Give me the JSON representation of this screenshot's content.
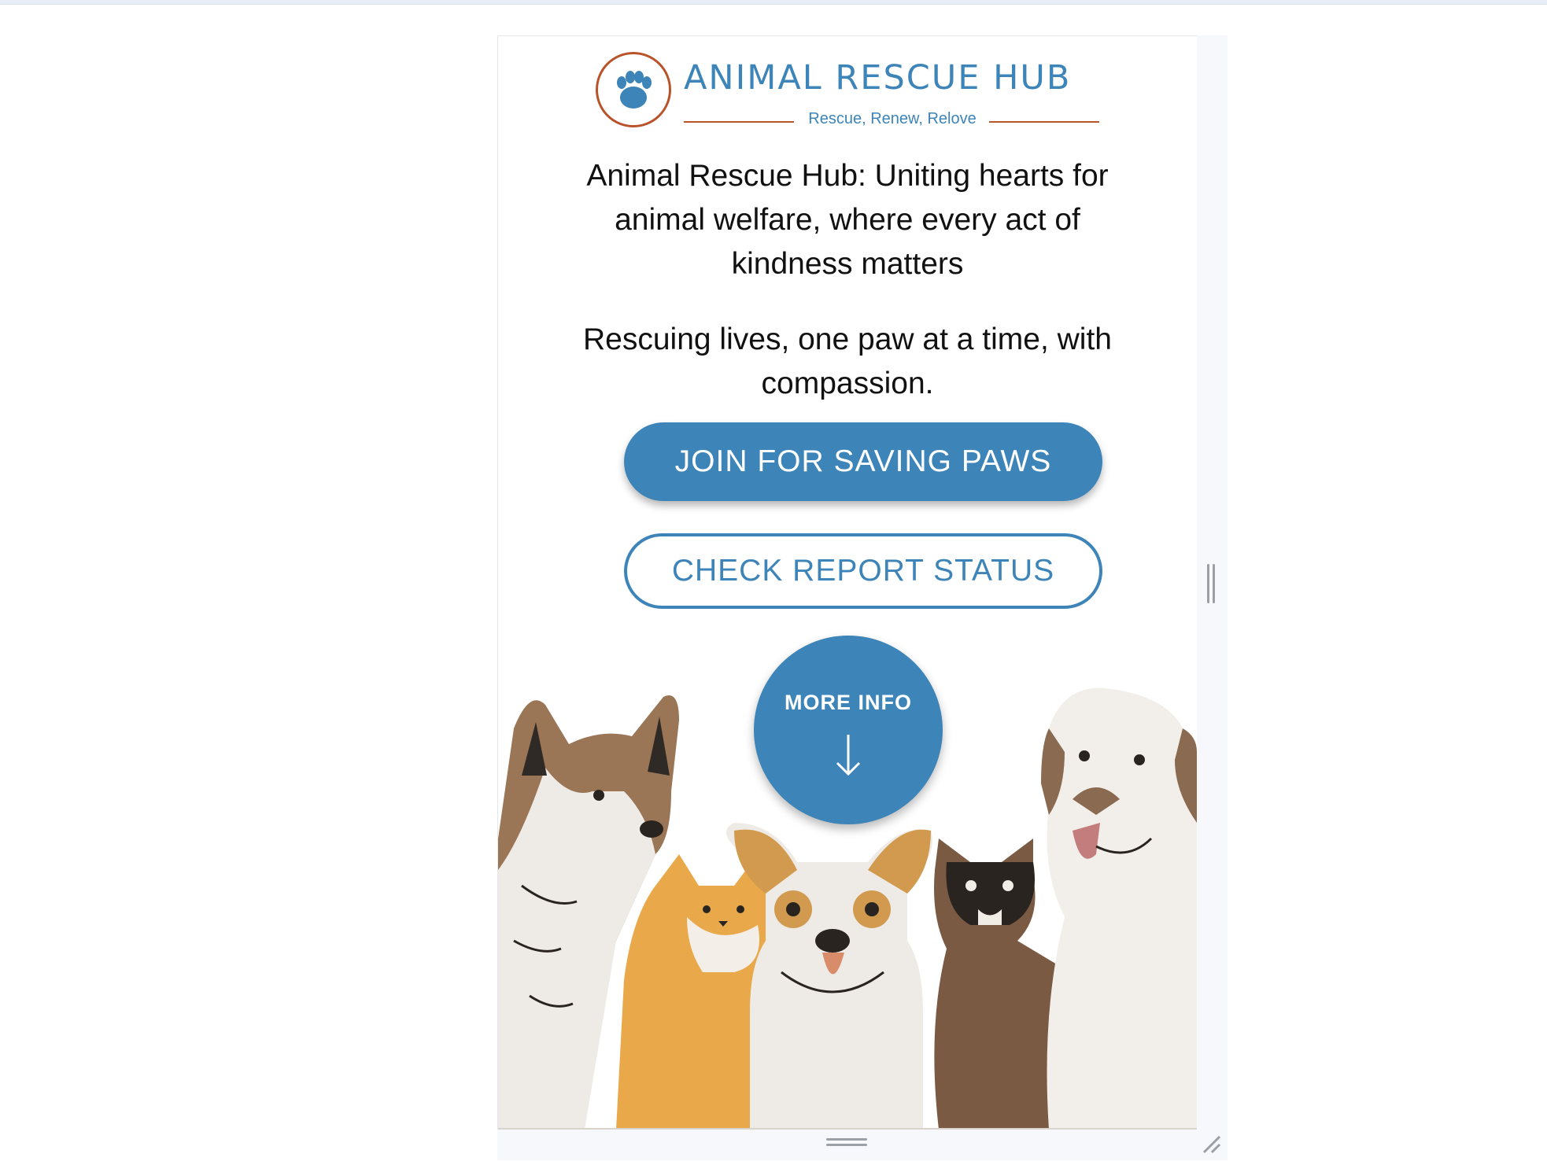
{
  "brand": {
    "name": "ANIMAL RESCUE HUB",
    "tagline": "Rescue, Renew, Relove",
    "colors": {
      "primary": "#3d84b8",
      "accent": "#b8532a"
    }
  },
  "hero": {
    "headline": "Animal Rescue Hub: Uniting hearts for animal welfare, where every act of kindness matters",
    "subline": "Rescuing lives, one paw at a time, with compassion."
  },
  "actions": {
    "join_label": "JOIN FOR SAVING PAWS",
    "status_label": "CHECK REPORT STATUS",
    "more_info_label": "MORE INFO"
  },
  "icons": {
    "logo": "paw-icon",
    "more_info": "arrow-down-icon"
  }
}
